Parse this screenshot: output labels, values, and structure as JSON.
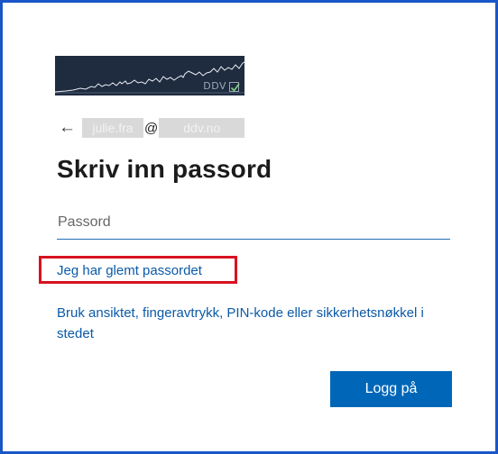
{
  "logo": {
    "text": "DDV"
  },
  "identity": {
    "username_redacted": " julie.fra ",
    "at": "@",
    "domain_redacted": "ddv.no"
  },
  "page": {
    "title": "Skriv inn passord"
  },
  "password": {
    "placeholder": "Passord",
    "value": ""
  },
  "links": {
    "forgot": "Jeg har glemt passordet",
    "alternative": "Bruk ansiktet, fingeravtrykk, PIN-kode eller sikkerhetsnøkkel i stedet"
  },
  "buttons": {
    "signin": "Logg på"
  },
  "colors": {
    "accent": "#0067b8",
    "link": "#0b5aa8",
    "highlight_box": "#d8121f",
    "frame": "#1a56c8",
    "logo_bg": "#1f2b3f"
  }
}
